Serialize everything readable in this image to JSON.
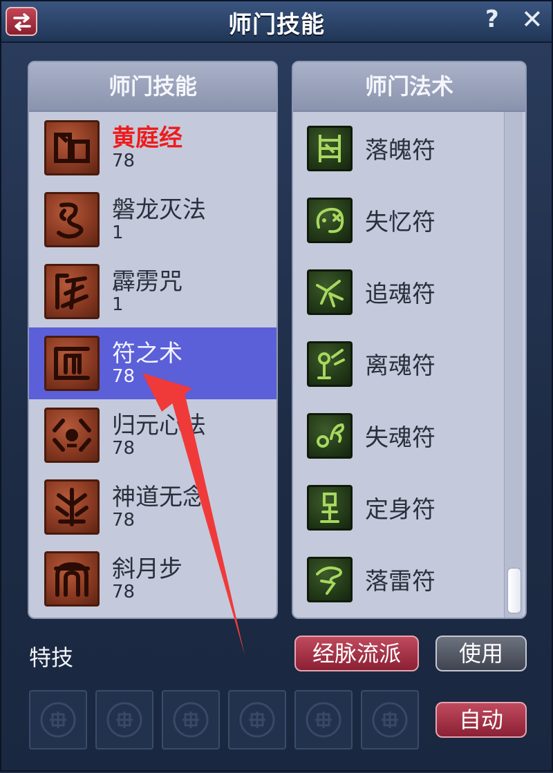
{
  "window": {
    "title": "师门技能",
    "help_label": "?",
    "close_label": "✕"
  },
  "left_panel": {
    "header": "师门技能",
    "skills": [
      {
        "name": "黄庭经",
        "level": "78",
        "icon": "book-glyph-icon",
        "highlighted": true
      },
      {
        "name": "磐龙灭法",
        "level": "1",
        "icon": "dragon-glyph-icon"
      },
      {
        "name": "霹雳咒",
        "level": "1",
        "icon": "thunder-glyph-icon"
      },
      {
        "name": "符之术",
        "level": "78",
        "icon": "talisman-glyph-icon",
        "selected": true
      },
      {
        "name": "归元心法",
        "level": "78",
        "icon": "heart-glyph-icon"
      },
      {
        "name": "神道无念",
        "level": "78",
        "icon": "divine-glyph-icon"
      },
      {
        "name": "斜月步",
        "level": "78",
        "icon": "moon-step-glyph-icon"
      }
    ]
  },
  "right_panel": {
    "header": "师门法术",
    "spells": [
      {
        "name": "落魄符",
        "icon": "talisman-green-icon"
      },
      {
        "name": "失忆符",
        "icon": "forget-green-icon"
      },
      {
        "name": "追魂符",
        "icon": "chase-soul-green-icon"
      },
      {
        "name": "离魂符",
        "icon": "leave-soul-green-icon"
      },
      {
        "name": "失魂符",
        "icon": "lose-soul-green-icon"
      },
      {
        "name": "定身符",
        "icon": "freeze-green-icon"
      },
      {
        "name": "落雷符",
        "icon": "thunder-green-icon"
      }
    ]
  },
  "footer": {
    "special_label": "特技",
    "meridian_button": "经脉流派",
    "use_button": "使用",
    "auto_button": "自动",
    "slot_count": 6
  },
  "colors": {
    "highlight_text": "#ee1c1c",
    "selected_row": "#5b5fd8",
    "annotation_arrow": "#f03a3a"
  }
}
